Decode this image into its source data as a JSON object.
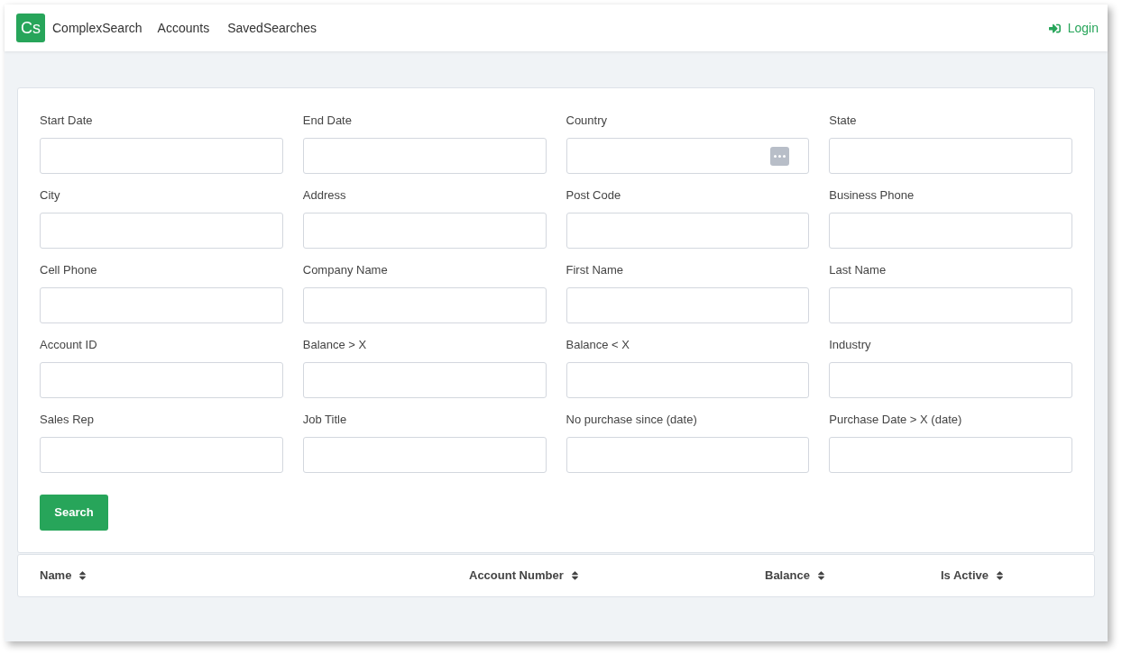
{
  "navbar": {
    "logo": "Cs",
    "brand": "ComplexSearch",
    "links": [
      "Accounts",
      "SavedSearches"
    ],
    "login": "Login"
  },
  "fields": [
    {
      "label": "Start Date",
      "kind": "text"
    },
    {
      "label": "End Date",
      "kind": "text"
    },
    {
      "label": "Country",
      "kind": "picker"
    },
    {
      "label": "State",
      "kind": "text"
    },
    {
      "label": "City",
      "kind": "text"
    },
    {
      "label": "Address",
      "kind": "text"
    },
    {
      "label": "Post Code",
      "kind": "text"
    },
    {
      "label": "Business Phone",
      "kind": "text"
    },
    {
      "label": "Cell Phone",
      "kind": "text"
    },
    {
      "label": "Company Name",
      "kind": "text"
    },
    {
      "label": "First Name",
      "kind": "text"
    },
    {
      "label": "Last Name",
      "kind": "text"
    },
    {
      "label": "Account ID",
      "kind": "text"
    },
    {
      "label": "Balance > X",
      "kind": "text"
    },
    {
      "label": "Balance < X",
      "kind": "text"
    },
    {
      "label": "Industry",
      "kind": "text"
    },
    {
      "label": "Sales Rep",
      "kind": "text"
    },
    {
      "label": "Job Title",
      "kind": "text"
    },
    {
      "label": "No purchase since (date)",
      "kind": "text"
    },
    {
      "label": "Purchase Date > X (date)",
      "kind": "text"
    }
  ],
  "search_button": "Search",
  "table": {
    "columns": [
      "Name",
      "Account Number",
      "Balance",
      "Is Active"
    ]
  }
}
